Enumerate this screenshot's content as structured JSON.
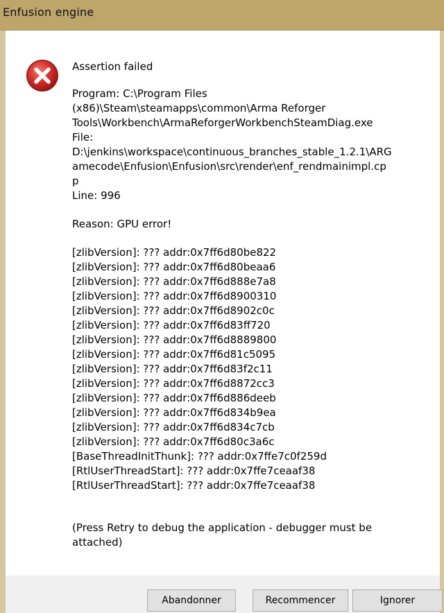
{
  "window": {
    "title": "Enfusion engine"
  },
  "icon": "error-icon",
  "colors": {
    "titlebar": "#bda56c",
    "error_red": "#d9302b"
  },
  "message": {
    "title": "Assertion failed",
    "program_lines": [
      "Program: C:\\Program Files",
      "(x86)\\Steam\\steamapps\\common\\Arma Reforger",
      "Tools\\Workbench\\ArmaReforgerWorkbenchSteamDiag.exe",
      "File:",
      "D:\\jenkins\\workspace\\continuous_branches_stable_1.2.1\\ARG",
      "amecode\\Enfusion\\Enfusion\\src\\render\\enf_rendmainimpl.cp",
      "p",
      "Line: 996"
    ],
    "reason": "Reason: GPU error!",
    "trace": [
      "[zlibVersion]: ??? addr:0x7ff6d80be822",
      "[zlibVersion]: ??? addr:0x7ff6d80beaa6",
      "[zlibVersion]: ??? addr:0x7ff6d888e7a8",
      "[zlibVersion]: ??? addr:0x7ff6d8900310",
      "[zlibVersion]: ??? addr:0x7ff6d8902c0c",
      "[zlibVersion]: ??? addr:0x7ff6d83ff720",
      "[zlibVersion]: ??? addr:0x7ff6d8889800",
      "[zlibVersion]: ??? addr:0x7ff6d81c5095",
      "[zlibVersion]: ??? addr:0x7ff6d83f2c11",
      "[zlibVersion]: ??? addr:0x7ff6d8872cc3",
      "[zlibVersion]: ??? addr:0x7ff6d886deeb",
      "[zlibVersion]: ??? addr:0x7ff6d834b9ea",
      "[zlibVersion]: ??? addr:0x7ff6d834c7cb",
      "[zlibVersion]: ??? addr:0x7ff6d80c3a6c",
      "[BaseThreadInitThunk]: ??? addr:0x7ffe7c0f259d",
      "[RtlUserThreadStart]: ??? addr:0x7ffe7ceaaf38",
      "[RtlUserThreadStart]: ??? addr:0x7ffe7ceaaf38"
    ],
    "footer": "(Press Retry to debug the application - debugger must be attached)"
  },
  "buttons": {
    "abandon": "Abandonner",
    "retry": "Recommencer",
    "ignore": "Ignorer"
  }
}
